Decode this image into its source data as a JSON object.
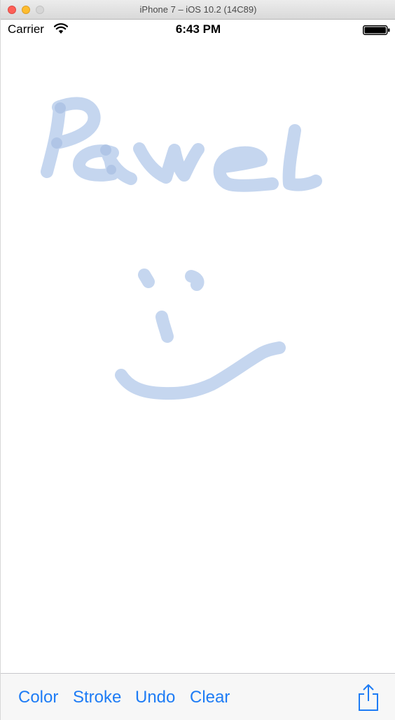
{
  "window": {
    "title": "iPhone 7 – iOS 10.2 (14C89)"
  },
  "status_bar": {
    "carrier": "Carrier",
    "time": "6:43 PM",
    "wifi_icon": "wifi-icon",
    "battery_icon": "battery-full-icon"
  },
  "canvas": {
    "stroke_color": "#c5d6ef",
    "overlap_color": "#a9c0e4",
    "content": "handwritten 'Pawel' and smiley face drawing"
  },
  "toolbar": {
    "color_label": "Color",
    "stroke_label": "Stroke",
    "undo_label": "Undo",
    "clear_label": "Clear",
    "share_icon": "share-icon"
  },
  "colors": {
    "accent": "#1e7cf5",
    "toolbar_bg": "#f7f7f7"
  }
}
